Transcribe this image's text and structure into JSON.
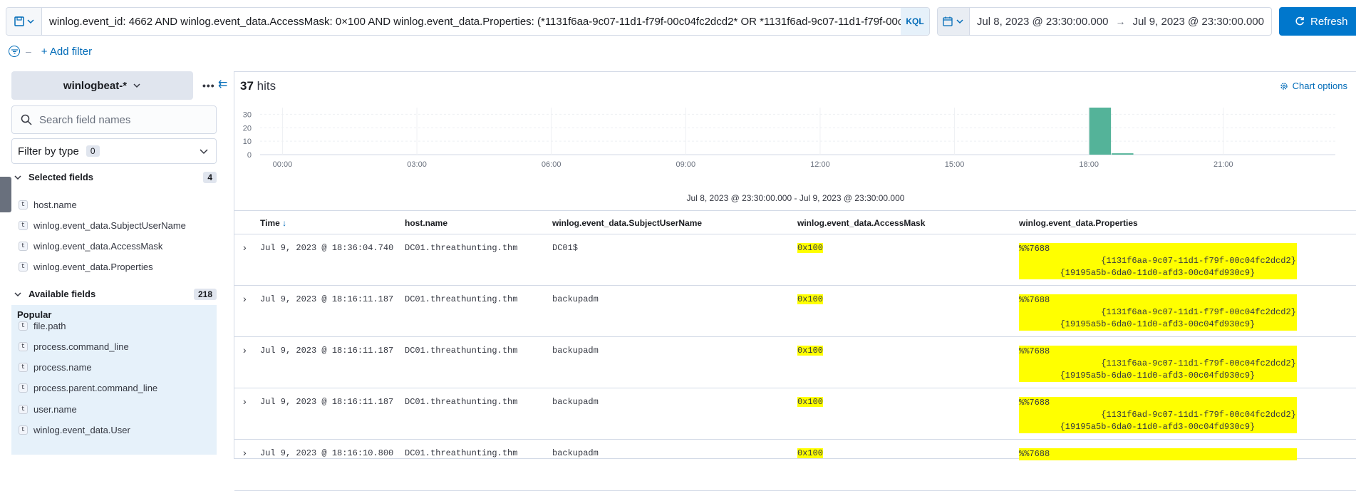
{
  "query": {
    "text": "winlog.event_id: 4662 AND winlog.event_data.AccessMask: 0×100 AND winlog.event_data.Properties: (*1131f6aa-9c07-11d1-f79f-00c04fc2dcd2* OR *1131f6ad-9c07-11d1-f79f-00c",
    "language": "KQL"
  },
  "timepicker": {
    "start": "Jul 8, 2023 @ 23:30:00.000",
    "end": "Jul 9, 2023 @ 23:30:00.000",
    "arrow": "→",
    "refresh_label": "Refresh"
  },
  "filters": {
    "add_label": "+ Add filter"
  },
  "sidebar": {
    "index_pattern": "winlogbeat-*",
    "search_placeholder": "Search field names",
    "filter_by_type": "Filter by type",
    "filter_count": "0",
    "selected_title": "Selected fields",
    "selected_count": "4",
    "selected": [
      "host.name",
      "winlog.event_data.SubjectUserName",
      "winlog.event_data.AccessMask",
      "winlog.event_data.Properties"
    ],
    "available_title": "Available fields",
    "available_count": "218",
    "popular_title": "Popular",
    "popular": [
      "file.path",
      "process.command_line",
      "process.name",
      "process.parent.command_line",
      "user.name",
      "winlog.event_data.User"
    ],
    "type_token": "t"
  },
  "main": {
    "hits_count": "37",
    "hits_label": "hits",
    "chart_options": "Chart options",
    "interval_label": "Jul 8, 2023 @ 23:30:00.000 - Jul 9, 2023 @ 23:30:00.000"
  },
  "chart_data": {
    "type": "bar",
    "y_ticks": [
      "30",
      "20",
      "10",
      "0"
    ],
    "x_ticks": [
      "00:00",
      "03:00",
      "06:00",
      "09:00",
      "12:00",
      "15:00",
      "18:00",
      "21:00"
    ],
    "ylim": [
      0,
      35
    ],
    "bars": [
      {
        "x": "18:00",
        "value": 36
      },
      {
        "x": "18:30",
        "value": 1
      }
    ],
    "color": "#54b399"
  },
  "table": {
    "columns": [
      "Time",
      "host.name",
      "winlog.event_data.SubjectUserName",
      "winlog.event_data.AccessMask",
      "winlog.event_data.Properties"
    ],
    "sort_indicator": "↓",
    "rows": [
      {
        "time": "Jul 9, 2023 @ 18:36:04.740",
        "host": "DC01.threathunting.thm",
        "user": "DC01$",
        "mask": "0x100",
        "props": "%%7688\n                {1131f6aa-9c07-11d1-f79f-00c04fc2dcd2}\n        {19195a5b-6da0-11d0-afd3-00c04fd930c9}"
      },
      {
        "time": "Jul 9, 2023 @ 18:16:11.187",
        "host": "DC01.threathunting.thm",
        "user": "backupadm",
        "mask": "0x100",
        "props": "%%7688\n                {1131f6aa-9c07-11d1-f79f-00c04fc2dcd2}\n        {19195a5b-6da0-11d0-afd3-00c04fd930c9}"
      },
      {
        "time": "Jul 9, 2023 @ 18:16:11.187",
        "host": "DC01.threathunting.thm",
        "user": "backupadm",
        "mask": "0x100",
        "props": "%%7688\n                {1131f6aa-9c07-11d1-f79f-00c04fc2dcd2}\n        {19195a5b-6da0-11d0-afd3-00c04fd930c9}"
      },
      {
        "time": "Jul 9, 2023 @ 18:16:11.187",
        "host": "DC01.threathunting.thm",
        "user": "backupadm",
        "mask": "0x100",
        "props": "%%7688\n                {1131f6ad-9c07-11d1-f79f-00c04fc2dcd2}\n        {19195a5b-6da0-11d0-afd3-00c04fd930c9}"
      },
      {
        "time": "Jul 9, 2023 @ 18:16:10.800",
        "host": "DC01.threathunting.thm",
        "user": "backupadm",
        "mask": "0x100",
        "props": "%%7688"
      }
    ]
  }
}
